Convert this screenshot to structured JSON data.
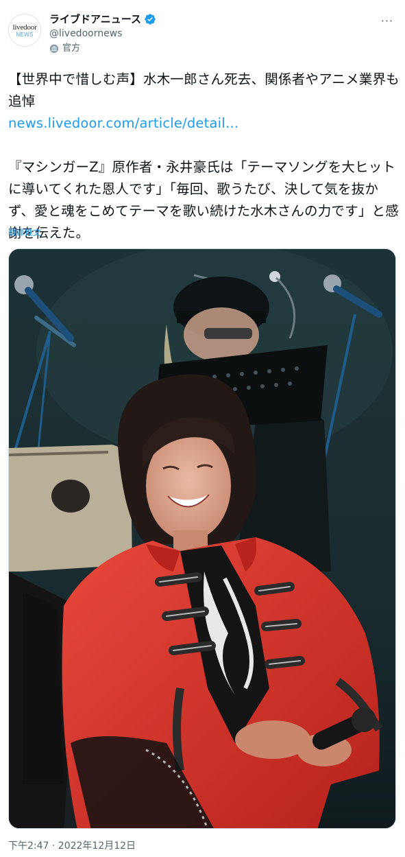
{
  "account": {
    "display_name": "ライブドアニュース",
    "handle": "@livedoornews",
    "label": "官方",
    "avatar_text_top": "livedoor",
    "avatar_text_bottom": "NEWS"
  },
  "tweet": {
    "headline": "【世界中で惜しむ声】水木一郎さん死去、関係者やアニメ業界も追悼",
    "link_text": "news.livedoor.com/article/detail…",
    "paragraph": "『マシンガーZ』原作者・永井豪氏は「テーマソングを大ヒットに導いてくれた恩人です」「毎回、歌うたび、決して気を抜かず、愛と魂をこめてテーマを歌い続けた水木さんの力です」と感謝を伝えた。",
    "translate_label": "翻译推文",
    "timestamp": "下午2:47 · 2022年12月12日"
  },
  "icons": {
    "verified": "verified-badge-icon",
    "official": "government-label-icon",
    "more": "more-options-icon"
  },
  "colors": {
    "link": "#1d9bf0",
    "secondary_text": "#536471",
    "jacket": "#d8322b"
  }
}
